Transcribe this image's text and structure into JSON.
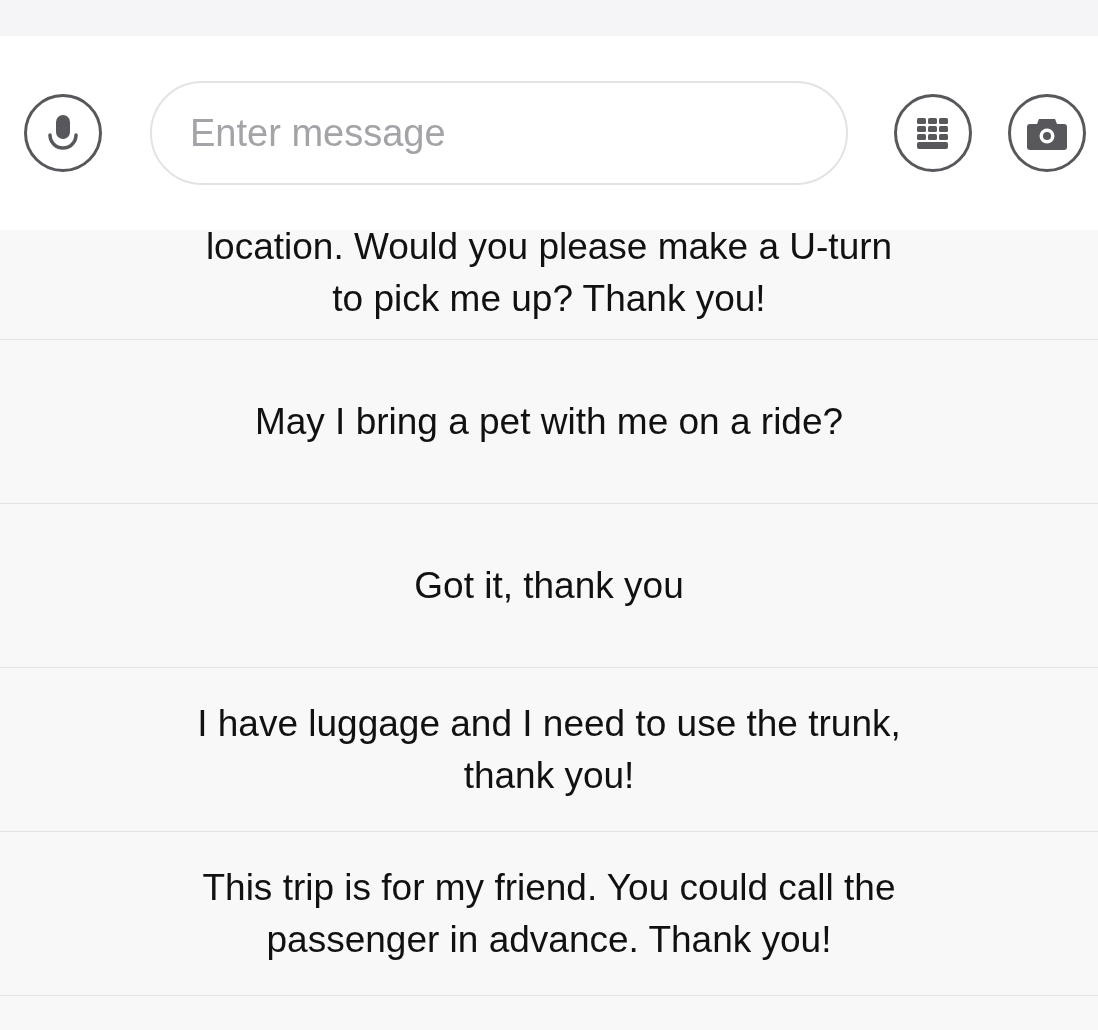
{
  "input_bar": {
    "placeholder": "Enter message"
  },
  "quick_replies": [
    {
      "text": "location. Would you please make a U-turn\nto pick me up? Thank you!",
      "cut": true
    },
    {
      "text": "May I bring a pet with me on a ride?",
      "cut": false
    },
    {
      "text": "Got it, thank you",
      "cut": false
    },
    {
      "text": "I have luggage and I need to use the trunk,\nthank you!",
      "cut": false
    },
    {
      "text": "This trip is for my friend. You could call the\npassenger in advance. Thank you!",
      "cut": false
    }
  ]
}
